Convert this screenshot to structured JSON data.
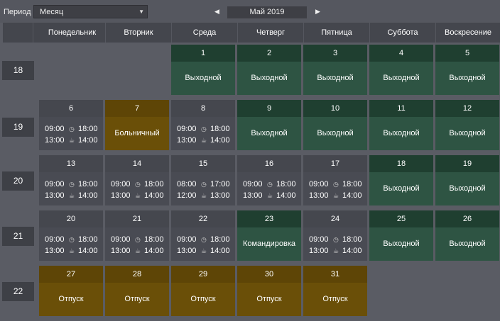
{
  "toolbar": {
    "period_label": "Период",
    "period_value": "Месяц",
    "month_label": "Май 2019",
    "prev_symbol": "◀",
    "next_symbol": "▶",
    "caret_symbol": "▼"
  },
  "weekdays": [
    "Понедельник",
    "Вторник",
    "Среда",
    "Четверг",
    "Пятница",
    "Суббота",
    "Воскресение"
  ],
  "weeks": [
    {
      "label": "18",
      "days": [
        null,
        null,
        {
          "num": "1",
          "type": "off",
          "status": "Выходной"
        },
        {
          "num": "2",
          "type": "off",
          "status": "Выходной"
        },
        {
          "num": "3",
          "type": "off",
          "status": "Выходной"
        },
        {
          "num": "4",
          "type": "off",
          "status": "Выходной"
        },
        {
          "num": "5",
          "type": "off",
          "status": "Выходной"
        }
      ]
    },
    {
      "label": "19",
      "days": [
        {
          "num": "6",
          "type": "work",
          "start": "09:00",
          "end": "18:00",
          "break_start": "13:00",
          "break_end": "14:00"
        },
        {
          "num": "7",
          "type": "gold",
          "status": "Больничный"
        },
        {
          "num": "8",
          "type": "work",
          "start": "09:00",
          "end": "18:00",
          "break_start": "13:00",
          "break_end": "14:00"
        },
        {
          "num": "9",
          "type": "off",
          "status": "Выходной"
        },
        {
          "num": "10",
          "type": "off",
          "status": "Выходной"
        },
        {
          "num": "11",
          "type": "off",
          "status": "Выходной"
        },
        {
          "num": "12",
          "type": "off",
          "status": "Выходной"
        }
      ]
    },
    {
      "label": "20",
      "days": [
        {
          "num": "13",
          "type": "work",
          "start": "09:00",
          "end": "18:00",
          "break_start": "13:00",
          "break_end": "14:00"
        },
        {
          "num": "14",
          "type": "work",
          "start": "09:00",
          "end": "18:00",
          "break_start": "13:00",
          "break_end": "14:00"
        },
        {
          "num": "15",
          "type": "work",
          "start": "08:00",
          "end": "17:00",
          "break_start": "12:00",
          "break_end": "13:00"
        },
        {
          "num": "16",
          "type": "work",
          "start": "09:00",
          "end": "18:00",
          "break_start": "13:00",
          "break_end": "14:00"
        },
        {
          "num": "17",
          "type": "work",
          "start": "09:00",
          "end": "18:00",
          "break_start": "13:00",
          "break_end": "14:00"
        },
        {
          "num": "18",
          "type": "off",
          "status": "Выходной"
        },
        {
          "num": "19",
          "type": "off",
          "status": "Выходной"
        }
      ]
    },
    {
      "label": "21",
      "days": [
        {
          "num": "20",
          "type": "work",
          "start": "09:00",
          "end": "18:00",
          "break_start": "13:00",
          "break_end": "14:00"
        },
        {
          "num": "21",
          "type": "work",
          "start": "09:00",
          "end": "18:00",
          "break_start": "13:00",
          "break_end": "14:00"
        },
        {
          "num": "22",
          "type": "work",
          "start": "09:00",
          "end": "18:00",
          "break_start": "13:00",
          "break_end": "14:00"
        },
        {
          "num": "23",
          "type": "off",
          "status": "Командировка"
        },
        {
          "num": "24",
          "type": "work",
          "start": "09:00",
          "end": "18:00",
          "break_start": "13:00",
          "break_end": "14:00"
        },
        {
          "num": "25",
          "type": "off",
          "status": "Выходной"
        },
        {
          "num": "26",
          "type": "off",
          "status": "Выходной"
        }
      ]
    },
    {
      "label": "22",
      "days": [
        {
          "num": "27",
          "type": "gold",
          "status": "Отпуск"
        },
        {
          "num": "28",
          "type": "gold",
          "status": "Отпуск"
        },
        {
          "num": "29",
          "type": "gold",
          "status": "Отпуск"
        },
        {
          "num": "30",
          "type": "gold",
          "status": "Отпуск"
        },
        {
          "num": "31",
          "type": "gold",
          "status": "Отпуск"
        },
        null,
        null
      ]
    }
  ],
  "icons": {
    "clock": "clock-icon",
    "break": "coffee-cup-icon"
  },
  "colors": {
    "work": "#494b53",
    "off": "#2e5443",
    "gold": "#6a4f08"
  }
}
